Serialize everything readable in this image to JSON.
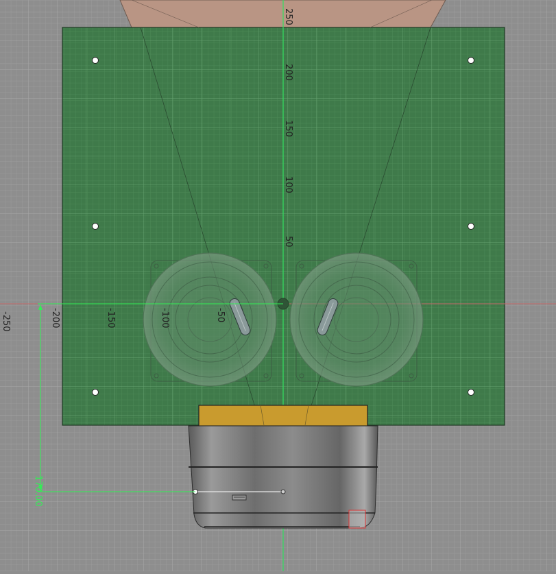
{
  "app": {
    "view": "CAD top sketch view"
  },
  "colors": {
    "background": "#8e8e8e",
    "grid_minor": "#9a9a9a",
    "grid_major": "#a6a6a6",
    "board": "#3f7a4a",
    "board_grid": "#5a9664",
    "axis_green": "#33e060",
    "axis_red": "#d06060",
    "horn": "#b99584",
    "plug": "#c99b2e",
    "dimension": "#33ee55",
    "label": "#222222"
  },
  "axis_ticks": {
    "y": [
      "250",
      "200",
      "150",
      "100",
      "50"
    ],
    "x": [
      "-250",
      "-200",
      "-150",
      "-100",
      "-50"
    ]
  },
  "dimension": {
    "value": "170.00"
  },
  "icons": {
    "mount_hole": "mount-hole-icon",
    "speaker": "speaker-icon",
    "knob": "knob-icon",
    "port": "usb-port-icon",
    "origin": "origin-point-icon"
  }
}
